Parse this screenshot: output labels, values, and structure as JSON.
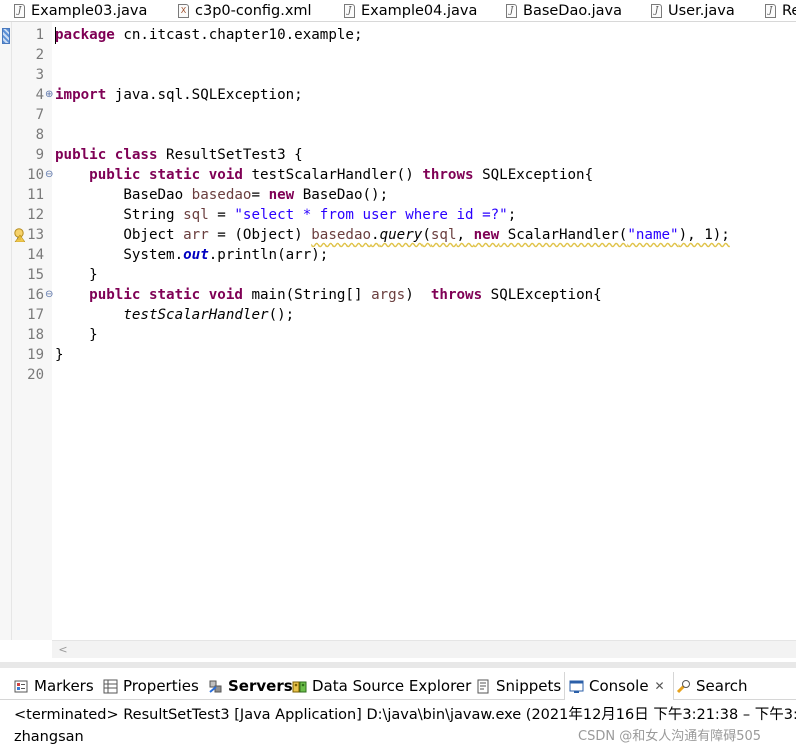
{
  "editor_tabs": [
    {
      "label": "Example03.java",
      "icon": "java-file-icon"
    },
    {
      "label": "c3p0-config.xml",
      "icon": "xml-file-icon"
    },
    {
      "label": "Example04.java",
      "icon": "java-file-icon"
    },
    {
      "label": "BaseDao.java",
      "icon": "java-file-icon"
    },
    {
      "label": "User.java",
      "icon": "java-file-icon"
    },
    {
      "label": "Re",
      "icon": "java-file-icon"
    }
  ],
  "line_numbers": [
    "1",
    "2",
    "3",
    "4",
    "7",
    "8",
    "9",
    "10",
    "11",
    "12",
    "13",
    "14",
    "15",
    "16",
    "17",
    "18",
    "19",
    "20"
  ],
  "code": {
    "l1_kw": "package",
    "l1_rest": " cn.itcast.chapter10.example;",
    "l4_kw": "import",
    "l4_rest": " java.sql.SQLException;",
    "l9_kw1": "public",
    "l9_kw2": "class",
    "l9_rest": " ResultSetTest3 {",
    "l10_indent": "    ",
    "l10_kw1": "public",
    "l10_kw2": "static",
    "l10_kw3": "void",
    "l10_mid": " testScalarHandler() ",
    "l10_kw4": "throws",
    "l10_rest": " SQLException{",
    "l11_a": "        BaseDao ",
    "l11_var": "basedao",
    "l11_b": "= ",
    "l11_kw": "new",
    "l11_c": " BaseDao();",
    "l12_a": "        String ",
    "l12_var": "sql",
    "l12_b": " = ",
    "l12_str": "\"select * from user where id =?\"",
    "l12_c": ";",
    "l13_a": "        Object ",
    "l13_var": "arr",
    "l13_b": " = (Object) ",
    "l13_var2": "basedao",
    "l13_dot": ".",
    "l13_method": "query",
    "l13_paren": "(",
    "l13_var3": "sql",
    "l13_comma": ", ",
    "l13_kw": "new",
    "l13_c": " ScalarHandler(",
    "l13_str": "\"name\"",
    "l13_d": "), 1);",
    "l14_a": "        System.",
    "l14_field": "out",
    "l14_b": ".println(arr);",
    "l15": "    }",
    "l16_indent": "    ",
    "l16_kw1": "public",
    "l16_kw2": "static",
    "l16_kw3": "void",
    "l16_mid": " main(String[] ",
    "l16_var": "args",
    "l16_sp": ")  ",
    "l16_kw4": "throws",
    "l16_rest": " SQLException{",
    "l17_indent": "        ",
    "l17_call": "testScalarHandler",
    "l17_rest": "();",
    "l18": "    }",
    "l19": "}"
  },
  "view_tabs": [
    {
      "label": "Markers",
      "icon": "markers-icon"
    },
    {
      "label": "Properties",
      "icon": "properties-icon"
    },
    {
      "label": "Servers",
      "icon": "servers-icon"
    },
    {
      "label": "Data Source Explorer",
      "icon": "data-source-explorer-icon"
    },
    {
      "label": "Snippets",
      "icon": "snippets-icon"
    },
    {
      "label": "Console",
      "icon": "console-icon"
    },
    {
      "label": "Search",
      "icon": "search-icon"
    }
  ],
  "console": {
    "status": "<terminated> ResultSetTest3 [Java Application] D:\\java\\bin\\javaw.exe  (2021年12月16日 下午3:21:38 – 下午3:",
    "output": "zhangsan"
  },
  "watermark": "CSDN @和女人沟通有障碍505",
  "colors": {
    "keyword": "#7f0055",
    "string": "#2a00ff",
    "local_variable": "#6a3e3e",
    "static_field": "#0000c0"
  }
}
